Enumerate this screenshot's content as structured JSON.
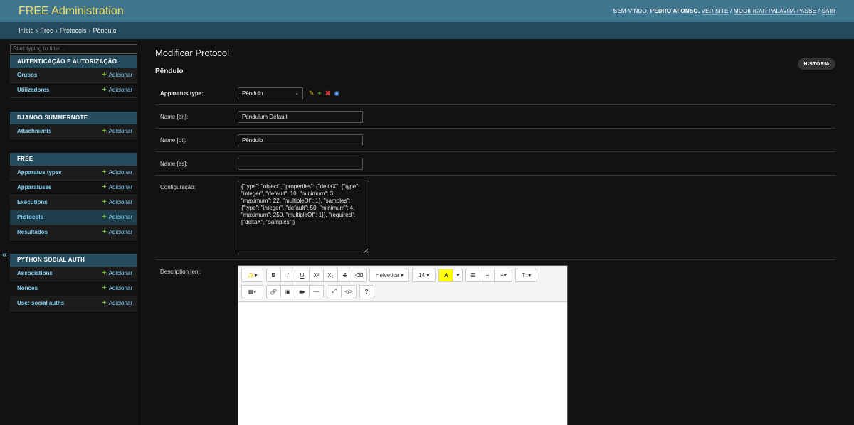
{
  "header": {
    "brand": "FREE Administration",
    "welcome": "BEM-VINDO,",
    "user": "PEDRO AFONSO.",
    "view_site": "VER SITE",
    "change_password": "MODIFICAR PALAVRA-PASSE",
    "logout": "SAIR",
    "sep": "/"
  },
  "breadcrumbs": [
    "Início",
    "Free",
    "Protocols",
    "Pêndulo"
  ],
  "breadcrumb_sep": "›",
  "sidebar": {
    "filter_placeholder": "Start typing to filter...",
    "add_label": "Adicionar",
    "modules": [
      {
        "caption": "AUTENTICAÇÃO E AUTORIZAÇÃO",
        "models": [
          "Grupos",
          "Utilizadores"
        ]
      },
      {
        "caption": "DJANGO SUMMERNOTE",
        "models": [
          "Attachments"
        ]
      },
      {
        "caption": "FREE",
        "models": [
          "Apparatus types",
          "Apparatuses",
          "Executions",
          "Protocols",
          "Resultados"
        ]
      },
      {
        "caption": "PYTHON SOCIAL AUTH",
        "models": [
          "Associations",
          "Nonces",
          "User social auths"
        ]
      }
    ],
    "collapse_glyph": "«"
  },
  "main": {
    "title": "Modificar Protocol",
    "object_name": "Pêndulo",
    "history_button": "HISTÓRIA",
    "fields": {
      "apparatus_type": {
        "label": "Apparatus type:",
        "value": "Pêndulo"
      },
      "name_en": {
        "label": "Name [en]:",
        "value": "Pendulum Default"
      },
      "name_pt": {
        "label": "Name [pt]:",
        "value": "Pêndulo"
      },
      "name_es": {
        "label": "Name [es]:",
        "value": ""
      },
      "config": {
        "label": "Configuração:",
        "value": "{\"type\": \"object\", \"properties\": {\"deltaX\": {\"type\": \"integer\", \"default\": 10, \"minimum\": 3, \"maximum\": 22, \"multipleOf\": 1}, \"samples\": {\"type\": \"integer\", \"default\": 50, \"minimum\": 4, \"maximum\": 250, \"multipleOf\": 1}}, \"required\": [\"deltaX\", \"samples\"]}"
      },
      "description_en": {
        "label": "Description [en]:"
      }
    },
    "editor": {
      "font_name": "Helvetica",
      "font_size": "14",
      "highlight_letter": "A",
      "text_style": "T↕"
    }
  },
  "colors": {
    "header": "#417690",
    "breadcrumbs": "#264b5d",
    "brand": "#f5dd5d",
    "link": "#81d4fa",
    "add_plus": "#70bf2b",
    "background": "#121212"
  }
}
